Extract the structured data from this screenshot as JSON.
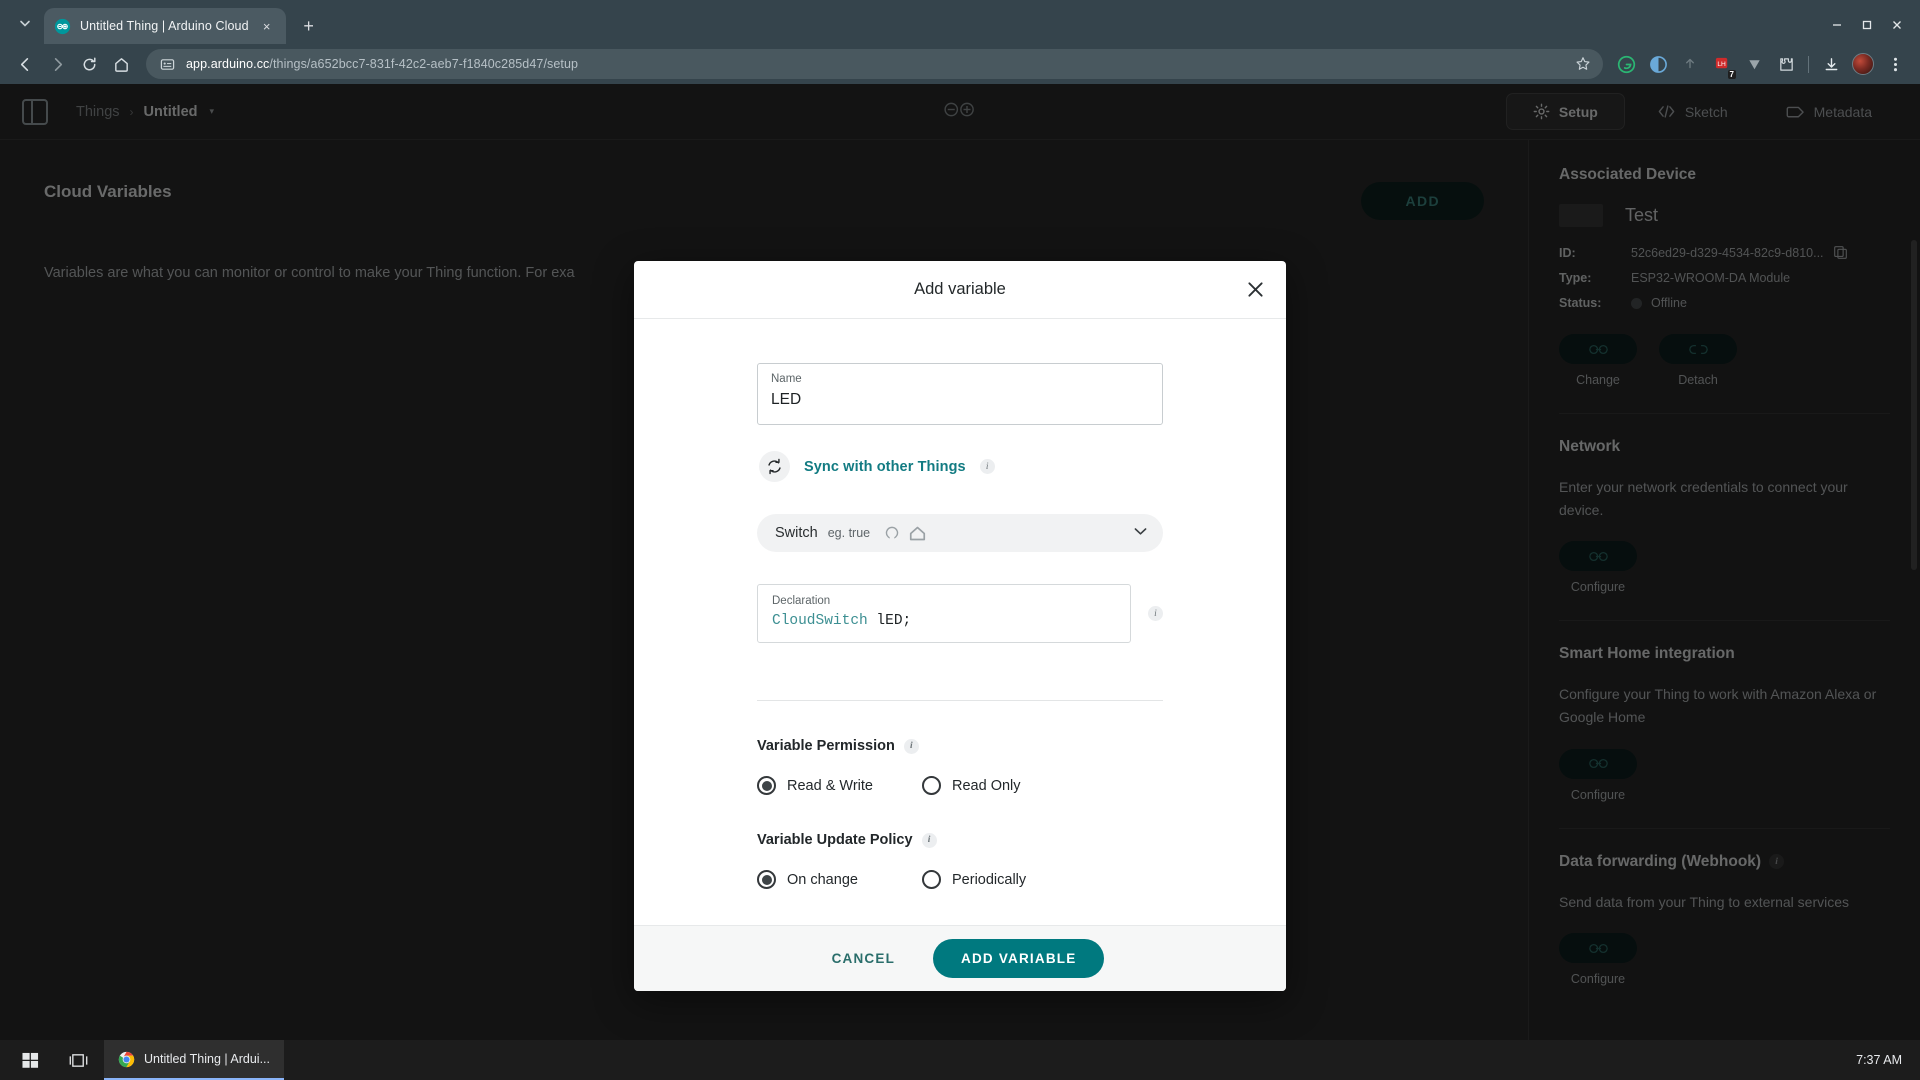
{
  "browser": {
    "tab": {
      "title": "Untitled Thing | Arduino Cloud",
      "favicon": "arduino-infinity-icon",
      "close": "×"
    },
    "new_tab_label": "+",
    "tab_list_caret": "⌄",
    "nav": {
      "back": "←",
      "forward": "→",
      "reload": "↻",
      "home": "⌂"
    },
    "omnibox": {
      "host": "app.arduino.cc",
      "path": "/things/a652bcc7-831f-42c2-aeb7-f1840c285d47/setup",
      "full_url": "app.arduino.cc/things/a652bcc7-831f-42c2-aeb7-f1840c285d47/setup",
      "site_info_icon": "page-info-icon",
      "bookmark_icon": "star-icon"
    },
    "extensions": [
      {
        "name": "grammarly-extension-icon",
        "glyph": "G"
      },
      {
        "name": "privacy-extension-icon",
        "glyph": "ⓘ"
      },
      {
        "name": "upload-extension-icon",
        "glyph": "↑"
      },
      {
        "name": "notifications-extension-icon",
        "glyph": "■",
        "badge": "7"
      },
      {
        "name": "vimium-extension-icon",
        "glyph": "V"
      },
      {
        "name": "extensions-puzzle-icon",
        "glyph": "⬟"
      }
    ],
    "downloads_icon": "download-icon",
    "profile_icon": "profile-avatar",
    "menu_icon": "three-dot-menu-icon",
    "window": {
      "minimize": "–",
      "maximize": "□",
      "close": "✕"
    }
  },
  "app_header": {
    "panel_toggle": "side-panel-toggle",
    "breadcrumb": {
      "root": "Things",
      "separator": "›",
      "current": "Untitled",
      "caret": "▾"
    },
    "logo": "arduino-infinity-logo",
    "tabs": [
      {
        "label": "Setup",
        "icon": "gear-icon",
        "active": true
      },
      {
        "label": "Sketch",
        "icon": "code-brackets-icon",
        "active": false
      },
      {
        "label": "Metadata",
        "icon": "tag-icon",
        "active": false
      }
    ]
  },
  "main": {
    "section_title": "Cloud Variables",
    "description": "Variables are what you can monitor or control to make your Thing function. For exa",
    "add_button": "ADD"
  },
  "sidebar": {
    "associated_device": {
      "title": "Associated Device",
      "device_name": "Test",
      "id_key": "ID:",
      "id_value": "52c6ed29-d329-4534-82c9-d810...",
      "copy_icon": "copy-icon",
      "type_key": "Type:",
      "type_value": "ESP32-WROOM-DA Module",
      "status_key": "Status:",
      "status_value": "Offline",
      "actions": [
        {
          "label": "Change",
          "icon": "link-icon"
        },
        {
          "label": "Detach",
          "icon": "broken-link-icon"
        }
      ]
    },
    "network": {
      "title": "Network",
      "description": "Enter your network credentials to connect your device.",
      "action": {
        "label": "Configure",
        "icon": "link-icon"
      }
    },
    "smart_home": {
      "title": "Smart Home integration",
      "description": "Configure your Thing to work with Amazon Alexa or Google Home",
      "action": {
        "label": "Configure",
        "icon": "link-icon"
      }
    },
    "webhook": {
      "title": "Data forwarding (Webhook)",
      "info_icon": "info-icon",
      "description": "Send data from your Thing to external services",
      "action": {
        "label": "Configure",
        "icon": "link-icon"
      }
    }
  },
  "modal": {
    "title": "Add variable",
    "close_icon": "close-icon",
    "name_field": {
      "label": "Name",
      "value": "LED"
    },
    "sync": {
      "icon": "sync-icon",
      "label": "Sync with other Things",
      "info_icon": "info-icon"
    },
    "type_select": {
      "type_name": "Switch",
      "example": "eg. true",
      "alexa_icon": "alexa-icon",
      "google_home_icon": "google-home-icon",
      "caret": "▾"
    },
    "declaration": {
      "label": "Declaration",
      "type_token": "CloudSwitch",
      "code_rest": " lED;",
      "info_icon": "info-icon"
    },
    "permission": {
      "title": "Variable Permission",
      "info_icon": "info-icon",
      "options": [
        {
          "label": "Read & Write",
          "selected": true
        },
        {
          "label": "Read Only",
          "selected": false
        }
      ]
    },
    "update_policy": {
      "title": "Variable Update Policy",
      "info_icon": "info-icon",
      "options": [
        {
          "label": "On change",
          "selected": true
        },
        {
          "label": "Periodically",
          "selected": false
        }
      ]
    },
    "footer": {
      "cancel": "CANCEL",
      "submit": "ADD VARIABLE"
    }
  },
  "taskbar": {
    "start_icon": "windows-start-icon",
    "task_view_icon": "task-view-icon",
    "task": {
      "label": "Untitled Thing | Ardui...",
      "icon": "chrome-icon"
    },
    "clock": "7:37 AM"
  },
  "colors": {
    "accent_teal": "#00797f",
    "link_teal": "#127b82",
    "browser_chrome": "#35444c",
    "app_bg": "#2b2b2b"
  }
}
